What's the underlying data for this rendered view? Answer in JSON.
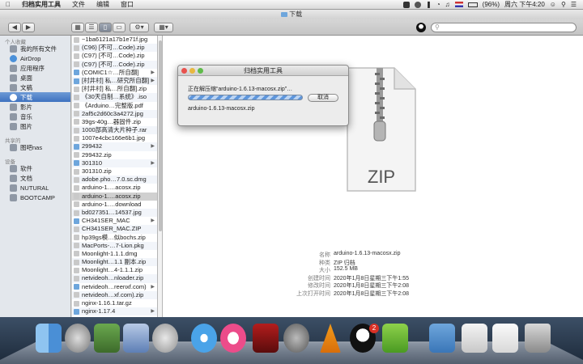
{
  "menubar": {
    "app_name": "归档实用工具",
    "items": [
      "文件",
      "编辑",
      "窗口"
    ],
    "battery": "(96%)",
    "clock": "周六 下午4:20"
  },
  "window": {
    "title": "下载"
  },
  "toolbar": {
    "search_placeholder": ""
  },
  "sidebar": {
    "sections": [
      {
        "header": "个人收藏",
        "items": [
          "我的所有文件",
          "AirDrop",
          "应用程序",
          "桌面",
          "文稿",
          "下载",
          "影片",
          "音乐",
          "图片"
        ]
      },
      {
        "header": "共享的",
        "items": [
          "图吧nas"
        ]
      },
      {
        "header": "设备",
        "items": [
          "软件",
          "文档",
          "NUTURAL",
          "BOOTCAMP"
        ]
      }
    ],
    "selected": "下载"
  },
  "filelist": [
    {
      "name": "~1ba6121a17b1e71f.jpg",
      "folder": false
    },
    {
      "name": "(C96) [不可…Code).zip",
      "folder": false
    },
    {
      "name": "(C97) [不可…Code).zip",
      "folder": false
    },
    {
      "name": "(C97) [不可…Code).zip",
      "folder": false
    },
    {
      "name": "(COMIC1☆…所自翻]",
      "folder": true
    },
    {
      "name": "[村井村] 私…研究所自翻]",
      "folder": true
    },
    {
      "name": "[村井村] 私…所自翻].zip",
      "folder": false
    },
    {
      "name": "《30天自制…系统》.iso",
      "folder": false
    },
    {
      "name": "《Arduino…完整版.pdf",
      "folder": false
    },
    {
      "name": "2af5c2d60c3a4272.jpg",
      "folder": false
    },
    {
      "name": "39gs-40g…器固件.zip",
      "folder": false
    },
    {
      "name": "1000部高清大片种子.rar",
      "folder": false
    },
    {
      "name": "1007e4cbc166e6b1.jpg",
      "folder": false
    },
    {
      "name": "299432",
      "folder": true
    },
    {
      "name": "299432.zip",
      "folder": false
    },
    {
      "name": "301310",
      "folder": true
    },
    {
      "name": "301310.zip",
      "folder": false
    },
    {
      "name": "adobe.pho…7.0.sc.dmg",
      "folder": false
    },
    {
      "name": "arduino-1.…acosx.zip",
      "folder": false
    },
    {
      "name": "arduino-1.…acosx.zip",
      "folder": false,
      "selected": true
    },
    {
      "name": "arduino-1.…download",
      "folder": false
    },
    {
      "name": "bd027351…14537.jpg",
      "folder": false
    },
    {
      "name": "CH341SER_MAC",
      "folder": true
    },
    {
      "name": "CH341SER_MAC.ZIP",
      "folder": false
    },
    {
      "name": "hp39gs模…似bochs.zip",
      "folder": false
    },
    {
      "name": "MacPorts-…7-Lion.pkg",
      "folder": false
    },
    {
      "name": "Moonlight-1.1.1.dmg",
      "folder": false
    },
    {
      "name": "Moonlight…1.1 副本.zip",
      "folder": false
    },
    {
      "name": "Moonlight…4-1.1.1.zip",
      "folder": false
    },
    {
      "name": "netvideoh…nloader.zip",
      "folder": false
    },
    {
      "name": "netvideoh…reenxf.com)",
      "folder": true
    },
    {
      "name": "netvideoh…xf.com).zip",
      "folder": false
    },
    {
      "name": "nginx-1.16.1.tar.gz",
      "folder": false
    },
    {
      "name": "nginx-1.17.4",
      "folder": true
    }
  ],
  "preview": {
    "icon_label": "ZIP",
    "meta": [
      {
        "key": "名称",
        "value": "arduino-1.6.13-macosx.zip"
      },
      {
        "key": "种类",
        "value": "ZIP 归档"
      },
      {
        "key": "大小",
        "value": "152.5 MB"
      },
      {
        "key": "创建时间",
        "value": "2020年1月8日星期三下午1:55"
      },
      {
        "key": "修改时间",
        "value": "2020年1月8日星期三下午2:08"
      },
      {
        "key": "上次打开时间",
        "value": "2020年1月8日星期三下午2:08"
      }
    ]
  },
  "dialog": {
    "title": "归档实用工具",
    "status": "正在解压缩“arduino-1.6.13-macosx.zip”…",
    "cancel_label": "取消",
    "filename": "arduino-1.6.13-macosx.zip"
  },
  "dock": {
    "qq_badge": "2"
  },
  "colors": {
    "selection": "#3e72bf",
    "dock_bg": "#2a3a4e"
  }
}
